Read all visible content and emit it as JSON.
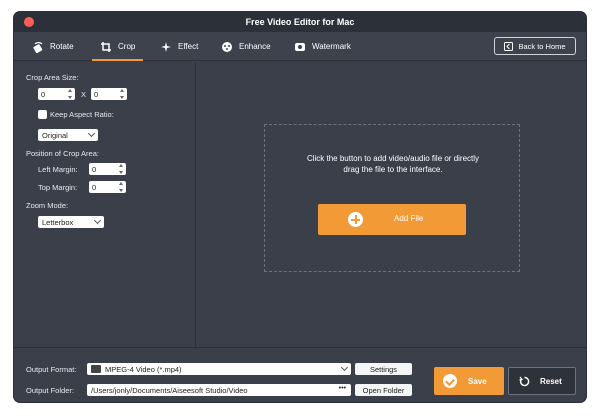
{
  "window": {
    "title": "Free Video Editor for Mac"
  },
  "toolbar": {
    "tabs": [
      {
        "label": "Rotate",
        "icon": "rotate-icon"
      },
      {
        "label": "Crop",
        "icon": "crop-icon",
        "active": true
      },
      {
        "label": "Effect",
        "icon": "effect-icon"
      },
      {
        "label": "Enhance",
        "icon": "enhance-icon"
      },
      {
        "label": "Watermark",
        "icon": "watermark-icon"
      }
    ],
    "back_label": "Back to Home"
  },
  "crop": {
    "area_size_label": "Crop Area Size:",
    "width_value": "0",
    "separator": "X",
    "height_value": "0",
    "keep_aspect_label": "Keep Aspect Ratio:",
    "aspect_value": "Original",
    "position_label": "Position of Crop Area:",
    "left_margin_label": "Left Margin:",
    "left_margin_value": "0",
    "top_margin_label": "Top Margin:",
    "top_margin_value": "0",
    "zoom_label": "Zoom Mode:",
    "zoom_value": "Letterbox"
  },
  "dropzone": {
    "line1": "Click the button to add video/audio file or directly",
    "line2": "drag the file to the interface.",
    "add_label": "Add File"
  },
  "output": {
    "format_label": "Output Format:",
    "format_value": "MPEG-4 Video (*.mp4)",
    "settings_label": "Settings",
    "folder_label": "Output Folder:",
    "folder_value": "/Users/jonly/Documents/Aiseesoft Studio/Video",
    "dots": "•••",
    "open_folder_label": "Open Folder",
    "save_label": "Save",
    "reset_label": "Reset"
  },
  "colors": {
    "accent": "#f29a36",
    "background": "#3a3f4a",
    "titlebar": "#2c3038"
  }
}
